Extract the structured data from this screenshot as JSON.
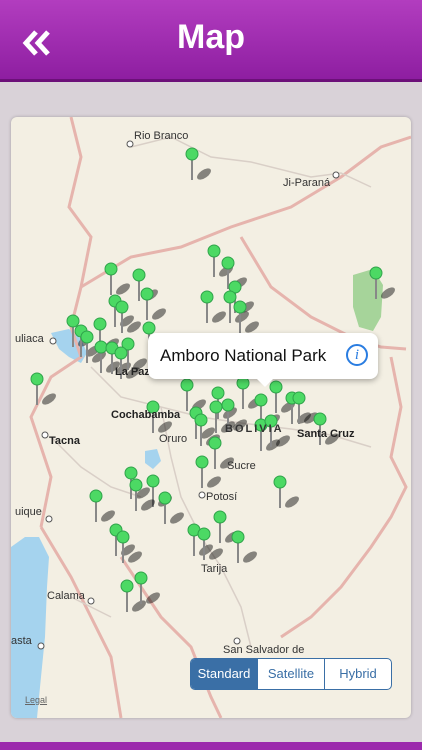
{
  "header": {
    "title": "Map",
    "back_icon": "double-chevron-left-icon"
  },
  "colors": {
    "header": "#9b2aac",
    "pin": "#4cd964",
    "water": "#a5d3ee",
    "segment_active": "#3a6fa6"
  },
  "map": {
    "cities": [
      "Rio Branco",
      "Ji-Paraná",
      "uliaca",
      "La Paz",
      "Cochabamba",
      "BOLIVIA",
      "Oruro",
      "Sucre",
      "Santa Cruz",
      "Tacna",
      "uique",
      "Potosí",
      "Tarija",
      "Calama",
      "asta",
      "San Salvador de Jujuy"
    ],
    "callout": {
      "title": "Amboro National Park",
      "info_icon": "info-icon"
    },
    "map_types": [
      "Standard",
      "Satellite",
      "Hybrid"
    ],
    "selected_map_type": "Standard",
    "legal": "Legal"
  }
}
